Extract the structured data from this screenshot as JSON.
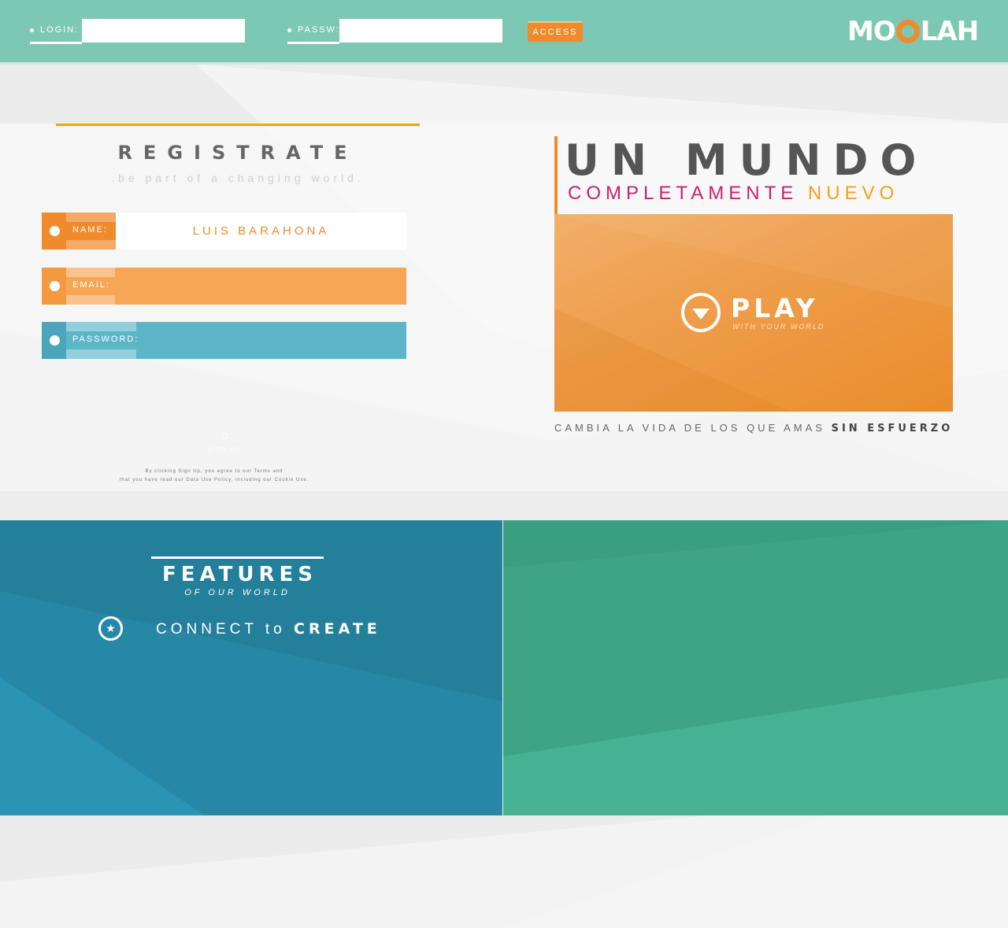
{
  "topbar": {
    "login_label": "LOGIN:",
    "login_value": "",
    "passw_label": "PASSW:",
    "passw_value": "",
    "access_label": "ACCESS",
    "logo_left": "MO",
    "logo_right": "LAH",
    "logo_ring_icon": "orange-ring-icon"
  },
  "register": {
    "title": "REGISTRATE",
    "subtitle": ".be part of a changing world.",
    "fields": [
      {
        "label": "NAME:",
        "value": "LUIS BARAHONA",
        "color": "#ef8b2c"
      },
      {
        "label": "EMAIL:",
        "value": "",
        "color": "#f6a655"
      },
      {
        "label": "PASSWORD:",
        "value": "",
        "color": "#5db5c8"
      }
    ],
    "signup_label": "SIGN UP",
    "terms_line1": "By clicking Sign Up, you agree to our Terms and",
    "terms_line2": "that you have read our Data Use Policy, including our Cookie Use."
  },
  "hero": {
    "headline": "UN MUNDO",
    "sub_pink": "COMPLETAMENTE",
    "sub_orange": "NUEVO",
    "play_title": "PLAY",
    "play_subtitle": "WITH YOUR WORLD",
    "play_icon": "play-down-arrow-icon",
    "tagline_plain": "CAMBIA LA VIDA DE LOS QUE AMAS",
    "tagline_bold": "SIN ESFUERZO"
  },
  "features": {
    "title": "FEATURES",
    "subtitle": "OF OUR WORLD",
    "item_icon": "star-icon",
    "item_plain": "CONNECT",
    "item_to": "to",
    "item_bold": "CREATE"
  },
  "colors": {
    "topbar": "#7cc8b4",
    "accent_orange": "#ef8b2c",
    "accent_yellow": "#f0a21a",
    "accent_pink": "#c8226a",
    "features_blue": "#247f9b",
    "features_green": "#3a9e80"
  }
}
